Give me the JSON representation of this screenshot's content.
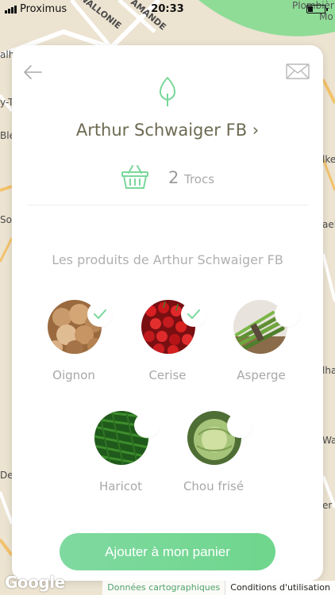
{
  "status_bar": {
    "carrier": "Proximus",
    "time": "20:33",
    "battery_level": 0.3
  },
  "map": {
    "labels": [
      "WALLONIE",
      "AMANDE",
      "Plombièr",
      "Mo",
      "alh",
      "y-T",
      "Blé",
      "lke",
      "So",
      "ael",
      "lha",
      "Wa",
      "De",
      "er"
    ]
  },
  "card": {
    "producer_name": "Arthur Schwaiger FB ›",
    "trocs_count": "2",
    "trocs_label": "Trocs",
    "section_title": "Les produits de Arthur Schwaiger FB",
    "products": [
      {
        "name": "Oignon",
        "selected": true
      },
      {
        "name": "Cerise",
        "selected": true
      },
      {
        "name": "Asperge",
        "selected": false
      },
      {
        "name": "Haricot",
        "selected": false
      },
      {
        "name": "Chou frisé",
        "selected": false
      }
    ],
    "cta_label": "Ajouter à mon panier"
  },
  "footer": {
    "google_logo": "Google",
    "map_data_link": "Données cartographiques",
    "terms_link": "Conditions d'utilisation"
  },
  "colors": {
    "accent": "#6fd68d",
    "title": "#6d6a52",
    "muted": "#a8a8a8"
  }
}
